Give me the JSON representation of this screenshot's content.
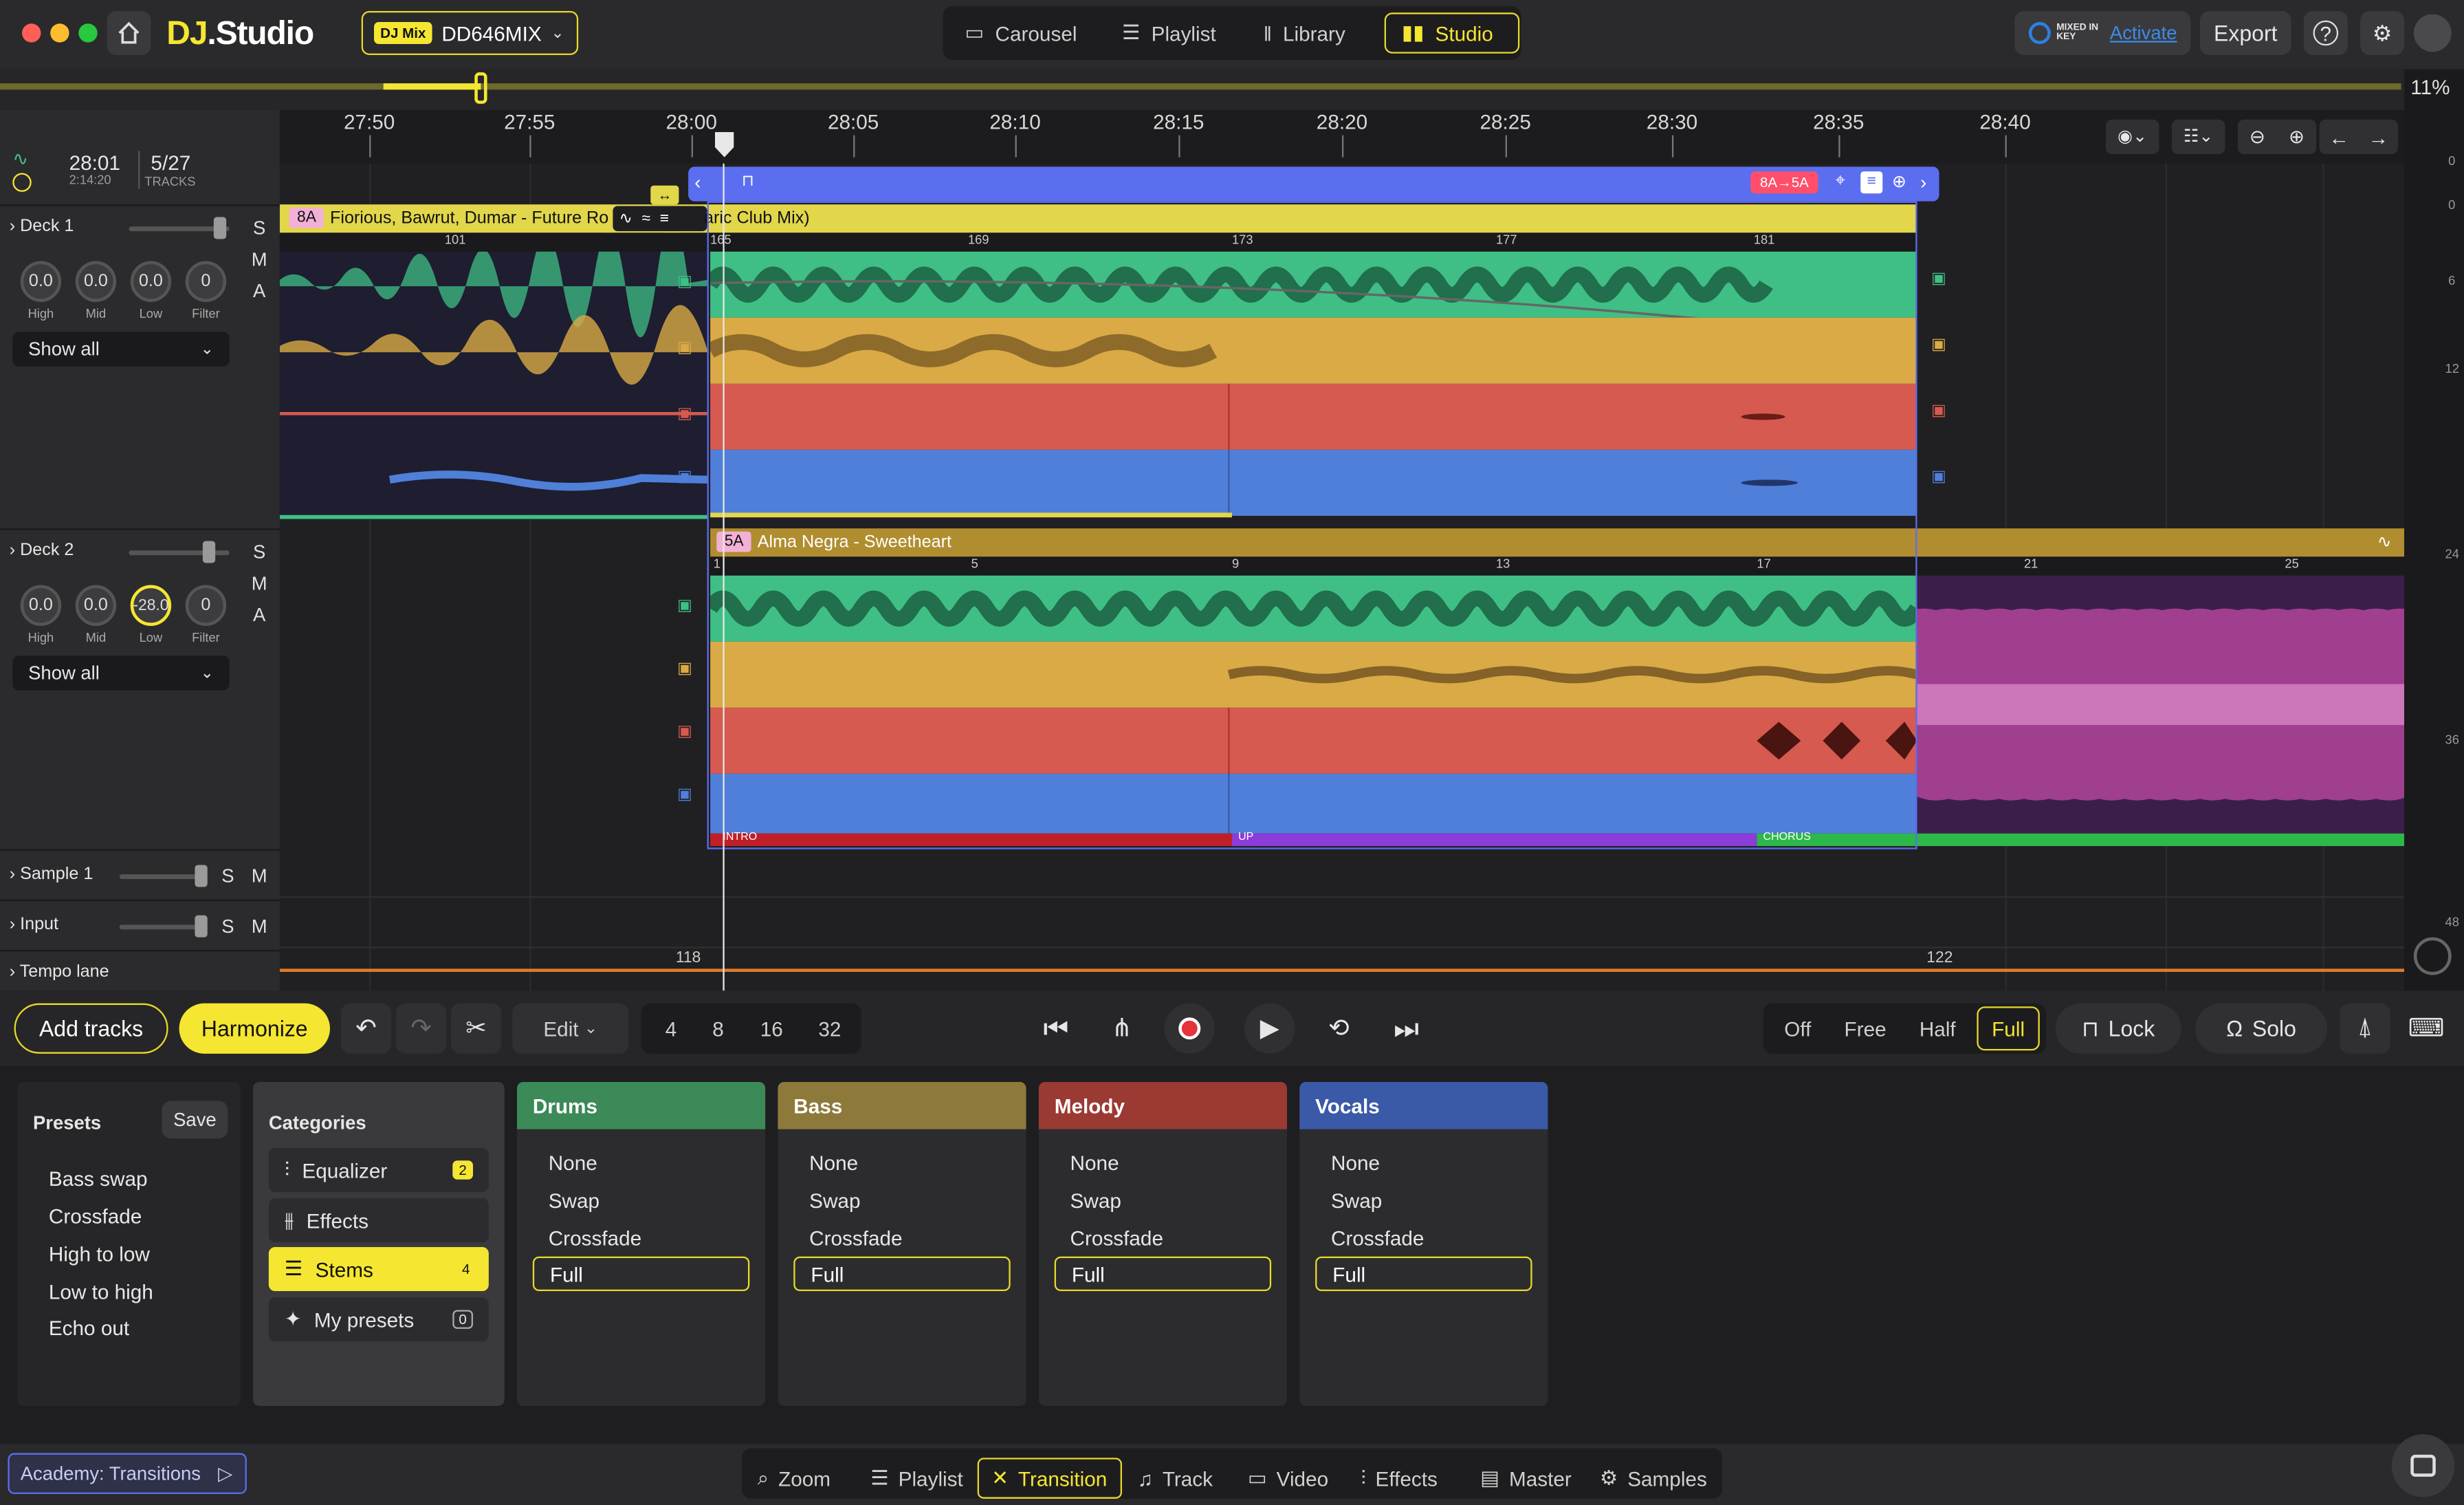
{
  "app": {
    "logo": "DJ.Studio",
    "logo_dj": "DJ",
    "logo_rest": ".Studio"
  },
  "mix": {
    "badge": "DJ Mix",
    "name": "DD646MIX"
  },
  "nav": {
    "carousel": "Carousel",
    "playlist": "Playlist",
    "library": "Library",
    "studio": "Studio"
  },
  "topright": {
    "mixed_in_key": "MIXED IN KEY",
    "activate": "Activate",
    "export": "Export"
  },
  "zoom_percent": "11%",
  "timeline": {
    "time": "28:01",
    "duration": "2:14:20",
    "tracks": "5/27",
    "tracks_label": "TRACKS",
    "ticks": [
      "27:50",
      "27:55",
      "28:00",
      "28:05",
      "28:10",
      "28:15",
      "28:20",
      "28:25",
      "28:30",
      "28:35",
      "28:40"
    ]
  },
  "deck1": {
    "name": "Deck 1",
    "knobs": [
      {
        "value": "0.0",
        "label": "High"
      },
      {
        "value": "0.0",
        "label": "Mid"
      },
      {
        "value": "0.0",
        "label": "Low"
      },
      {
        "value": "0",
        "label": "Filter"
      }
    ],
    "show_all": "Show all",
    "track_key": "8A",
    "track_title_a": "Fiorious, Bawrut, Dumar - Future Ro",
    "track_title_b": "aric Club Mix)",
    "bars": [
      "101",
      "165",
      "169",
      "173",
      "177",
      "181"
    ]
  },
  "deck2": {
    "name": "Deck 2",
    "knobs": [
      {
        "value": "0.0",
        "label": "High"
      },
      {
        "value": "0.0",
        "label": "Mid"
      },
      {
        "value": "-28.0",
        "label": "Low"
      },
      {
        "value": "0",
        "label": "Filter"
      }
    ],
    "show_all": "Show all",
    "track_key": "5A",
    "track_title": "Alma Negra - Sweetheart",
    "bars": [
      "1",
      "5",
      "9",
      "13",
      "17",
      "21",
      "25"
    ],
    "sections": [
      "INTRO",
      "UP",
      "CHORUS"
    ]
  },
  "transition": {
    "key_change": "8A→5A"
  },
  "lanes": {
    "sample": "Sample 1",
    "input": "Input",
    "tempo": "Tempo lane",
    "tempo_start": "118",
    "tempo_end": "122"
  },
  "smbuttons": {
    "s": "S",
    "m": "M",
    "a": "A"
  },
  "meter_labels": [
    "0",
    "6",
    "12",
    "24",
    "36",
    "48"
  ],
  "transport": {
    "add_tracks": "Add tracks",
    "harmonize": "Harmonize",
    "edit": "Edit",
    "beats": [
      "4",
      "8",
      "16",
      "32"
    ],
    "sync": [
      "Off",
      "Free",
      "Half",
      "Full"
    ],
    "lock": "Lock",
    "solo": "Solo"
  },
  "presets": {
    "title": "Presets",
    "save": "Save",
    "items": [
      "Bass swap",
      "Crossfade",
      "High to low",
      "Low to high",
      "Echo out"
    ]
  },
  "categories": {
    "title": "Categories",
    "items": [
      {
        "label": "Equalizer",
        "badge": "2"
      },
      {
        "label": "Effects",
        "badge": ""
      },
      {
        "label": "Stems",
        "badge": "4"
      },
      {
        "label": "My presets",
        "badge": "0"
      }
    ]
  },
  "stems": [
    {
      "name": "Drums",
      "color": "#3b8a57",
      "options": [
        "None",
        "Swap",
        "Crossfade"
      ],
      "selected": "Full"
    },
    {
      "name": "Bass",
      "color": "#8d7a3a",
      "options": [
        "None",
        "Swap",
        "Crossfade"
      ],
      "selected": "Full"
    },
    {
      "name": "Melody",
      "color": "#9a3a33",
      "options": [
        "None",
        "Swap",
        "Crossfade"
      ],
      "selected": "Full"
    },
    {
      "name": "Vocals",
      "color": "#3a5aa8",
      "options": [
        "None",
        "Swap",
        "Crossfade"
      ],
      "selected": "Full"
    }
  ],
  "footer": {
    "academy": "Academy: Transitions",
    "tabs": [
      "Zoom",
      "Playlist",
      "Transition",
      "Track",
      "Video",
      "Effects",
      "Master",
      "Samples"
    ]
  },
  "colors": {
    "accent": "#f5e631",
    "drums": "#3fbf85",
    "bass": "#d9aa45",
    "melody": "#d65a4f",
    "vocals": "#4f7fd9",
    "transition": "#5b6ef0"
  }
}
